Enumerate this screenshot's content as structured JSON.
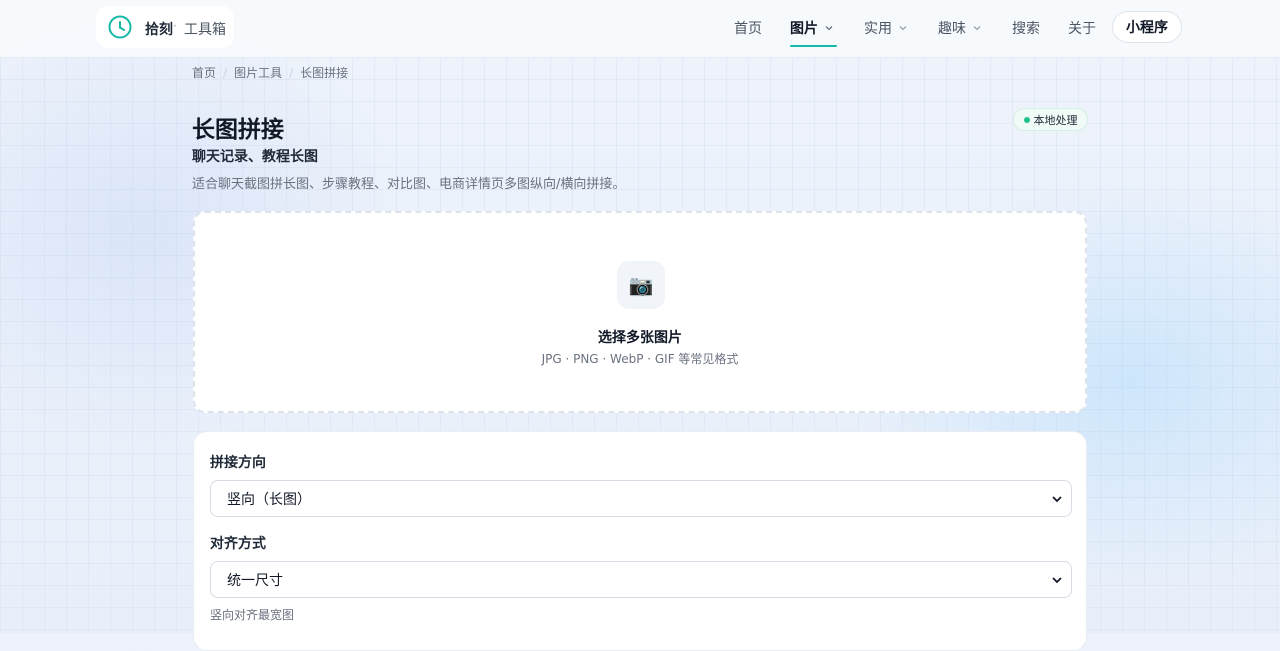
{
  "brand": {
    "name": "拾刻",
    "separator": "·",
    "sub": "工具箱"
  },
  "nav": {
    "items": [
      {
        "label": "首页"
      },
      {
        "label": "图片"
      },
      {
        "label": "实用"
      },
      {
        "label": "趣味"
      },
      {
        "label": "搜索"
      },
      {
        "label": "关于"
      }
    ],
    "mini_program": "小程序"
  },
  "breadcrumb": {
    "items": [
      "首页",
      "图片工具",
      "长图拼接"
    ],
    "separator": "/"
  },
  "page": {
    "title": "长图拼接",
    "subtitle": "聊天记录、教程长图",
    "description": "适合聊天截图拼长图、步骤教程、对比图、电商详情页多图纵向/横向拼接。",
    "badge": "本地处理"
  },
  "upload": {
    "icon": "📷",
    "title": "选择多张图片",
    "hint": "JPG · PNG · WebP · GIF 等常见格式"
  },
  "settings": {
    "direction_label": "拼接方向",
    "direction_value": "竖向（长图）",
    "align_label": "对齐方式",
    "align_value": "统一尺寸",
    "align_hint": "竖向对齐最宽图"
  },
  "colors": {
    "accent": "#14b8a6",
    "badge_dot": "#22c08a"
  }
}
